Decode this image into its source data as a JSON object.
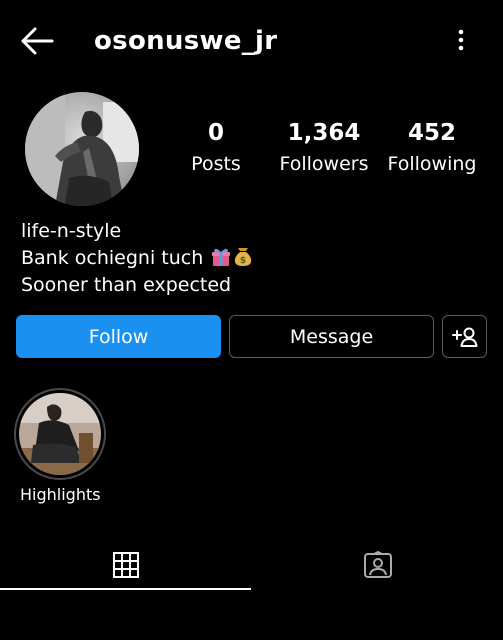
{
  "header": {
    "username": "osonuswe_jr",
    "back_icon": "arrow-left-icon",
    "more_icon": "vertical-dots-icon"
  },
  "stats": {
    "posts_count": "0",
    "posts_label": "Posts",
    "followers_count": "1,364",
    "followers_label": "Followers",
    "following_count": "452",
    "following_label": "Following"
  },
  "bio": {
    "line1": "life-n-style",
    "line2": "Bank ochiegni tuch",
    "line2_emojis": [
      "gift-emoji",
      "money-bag-emoji"
    ],
    "line3": "Sooner than expected"
  },
  "actions": {
    "follow_label": "Follow",
    "message_label": "Message",
    "add_user_icon": "add-person-icon"
  },
  "highlights": [
    {
      "label": "Highlights"
    }
  ],
  "tabs": {
    "grid_icon": "grid-icon",
    "tagged_icon": "tagged-person-icon",
    "active": "grid"
  },
  "colors": {
    "background": "#000000",
    "text": "#ffffff",
    "follow_button": "#1a90f0",
    "button_border": "#5a5a5a"
  }
}
